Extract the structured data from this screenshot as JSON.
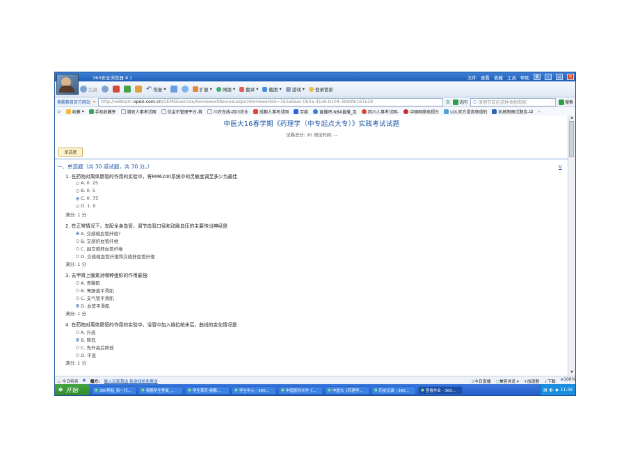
{
  "browser": {
    "title": "360安全浏览器 8.1",
    "menu": [
      "文件",
      "查看",
      "收藏",
      "工具",
      "帮助"
    ]
  },
  "toolbar": {
    "back_label": "后退",
    "undo_label": "恢复",
    "extend_label": "扩展",
    "netbank_label": "网银",
    "translate_label": "翻译",
    "screenshot_label": "截图",
    "game_label": "游戏",
    "login_label": "登录管家"
  },
  "address": {
    "site_label": "奥鹏教育官方网站",
    "url_prefix": "http://oldlearn.",
    "url_host": "open.com.cn",
    "url_path": "/OEMSExercise/HomeworkReview.aspx?HomeworkId=7d3a6eac-060a-41a6-b104-3b99fe167e19",
    "go_label": "访问",
    "search_placeholder": "清明节前后这种食物有剧",
    "search_button": "搜索"
  },
  "favorites": [
    "收藏",
    "手机收藏夹",
    "猎安人事考试网",
    "优金币管理平台-首",
    "川农在线-四川农业",
    "成都人事考试网",
    "百度",
    "直播吧-NBA直播_足",
    "四川人事考试网-",
    "中国网络电视台",
    "LOL官方语音频道的",
    "机械制图试题库-中"
  ],
  "page": {
    "title": "中医大16春学期《药理学（中专起点大专）》实践考试试题",
    "meta": "试卷总分: 30    测试时间: --",
    "tab": "单选题",
    "section": "一、单选题（共 30 道试题，共 30 分。）",
    "v_link": "V"
  },
  "questions": [
    {
      "text": "1. 在药物对离体肠管的作用的实验中，将RM6240系统中的灵敏度调至多少为最佳",
      "options": [
        "A. 0. 25",
        "B. 0. 5",
        "C. 0. 75",
        "D. 1. 0"
      ],
      "selected": 2,
      "score": "满分: 1 分"
    },
    {
      "text": "2. 在正常情况下，支配全身血管，调节血管口径和动脉血压的主要传出神经是",
      "options": [
        "A. 交感缩血管纤维?",
        "B. 交感舒血管纤维",
        "C. 副交感舒血管纤维",
        "D. 交感缩血管纤维和交感舒血管纤维"
      ],
      "selected": 0,
      "score": "满分: 1 分"
    },
    {
      "text": "3. 去甲肾上腺素对哪种组织的作用最强:",
      "options": [
        "A. 骨骼肌",
        "B. 胃肠道平滑肌",
        "C. 支气管平滑肌",
        "D. 血管平滑肌"
      ],
      "selected": 3,
      "score": "满分: 1 分"
    },
    {
      "text": "4. 在药物对离体肠管的作用的实验中，浴管中加入维拉帕米后，曲线的变化情况是",
      "options": [
        "A. 升高",
        "B. 降低",
        "C. 先升高后降低",
        "D. 平直"
      ],
      "selected": 1,
      "score": "满分: 1 分"
    }
  ],
  "statusbar": {
    "left": "今日特卖",
    "tip_label": "魔方:",
    "tip_link": "鼓人玩家首选 新游戏抢免费送",
    "items": [
      "今日直播",
      "兼容浏览",
      "加速器",
      "下载",
      "100%"
    ]
  },
  "taskbar": {
    "start_label": "开始",
    "tasks": [
      "360导航_新一代...",
      "奥鹏学生登录_...",
      "学生首页-奥鹏...",
      "学生中心 - 360...",
      "中国医科大学《...",
      "中医大《药理学...",
      "历史记录 - 360...",
      "查看作业 - 360..."
    ],
    "active_task": 7,
    "clock": "11:39"
  }
}
